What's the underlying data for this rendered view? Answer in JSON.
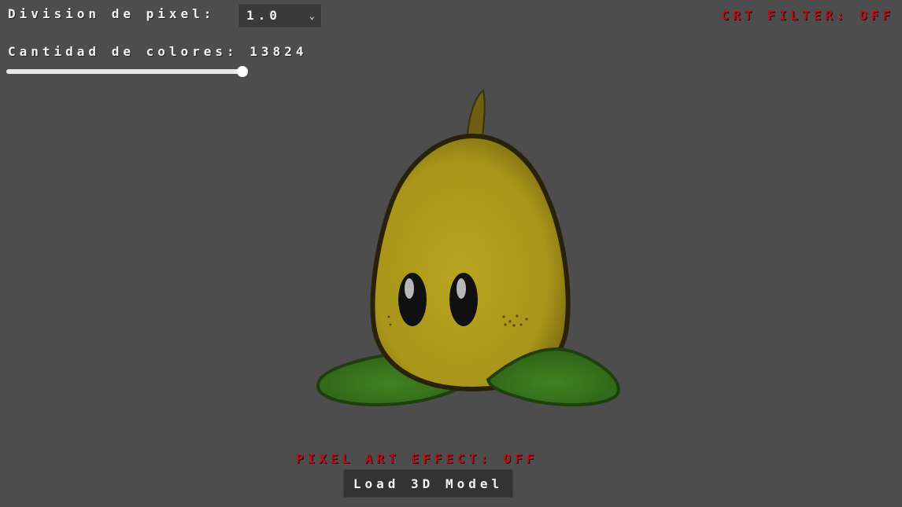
{
  "controls": {
    "division_label": "Division de pixel:",
    "division_value": "1.0",
    "crt_label": "CRT FILTER: OFF",
    "colors_label": "Cantidad de colores: 13824",
    "colors_slider_level": 1.0,
    "pixel_effect_label": "PIXEL ART EFFECT: OFF",
    "load_button_label": "Load 3D Model"
  },
  "viewport": {
    "model": "pear-plant-model"
  },
  "colors": {
    "background": "#4d4d4d",
    "accent_red": "#b5121b",
    "pear_body": "#b3a21f",
    "leaf_green": "#3e7d20"
  }
}
